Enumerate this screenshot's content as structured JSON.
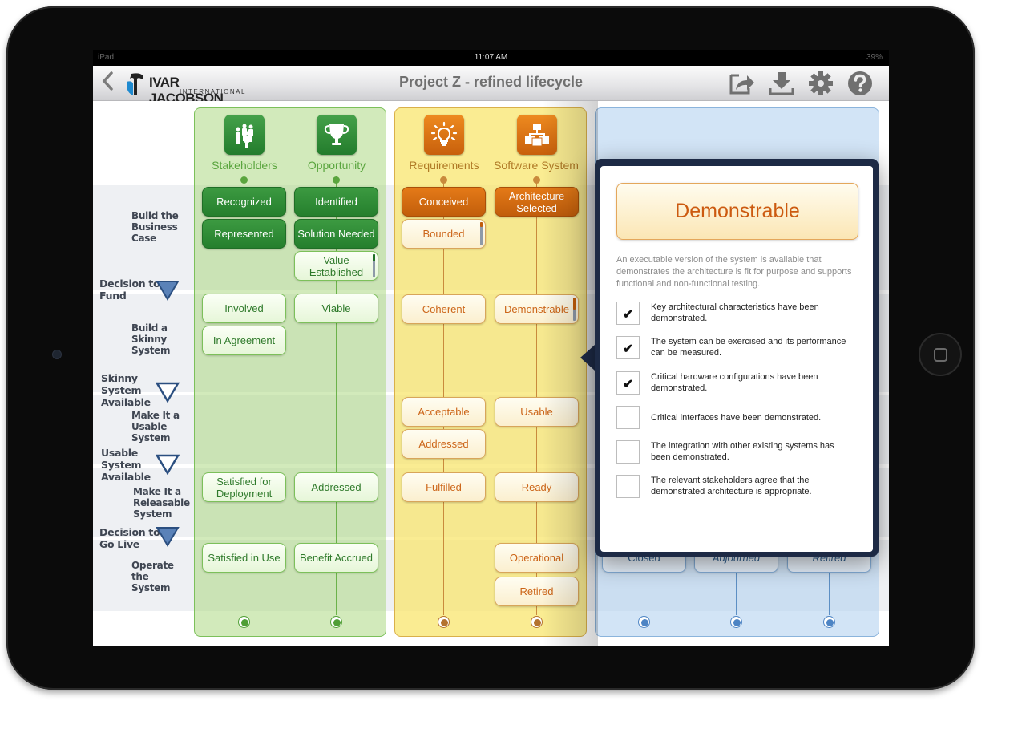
{
  "status_bar": {
    "device": "iPad",
    "time": "11:07 AM",
    "battery": "39%"
  },
  "nav": {
    "back_icon": "chevron-left-icon",
    "logo_name": "IVAR JACOBSON",
    "logo_sub": "INTERNATIONAL",
    "title": "Project Z - refined lifecycle",
    "icons": [
      "share-icon",
      "download-icon",
      "gear-icon",
      "help-icon"
    ]
  },
  "colors": {
    "green": "#2f8a35",
    "orange": "#d86d12",
    "blue": "#4d84c4",
    "popover_frame": "#1d2a45"
  },
  "phases": {
    "activities": [
      "Build the Business Case",
      "Build a Skinny System",
      "Make It a Usable System",
      "Make It a Releasable System",
      "Operate the System"
    ],
    "milestones": [
      {
        "label": "Decision to Fund",
        "style": "filled"
      },
      {
        "label": "Skinny System Available",
        "style": "outline"
      },
      {
        "label": "Usable System Available",
        "style": "outline"
      },
      {
        "label": "Decision to Go Live",
        "style": "filled"
      }
    ]
  },
  "alphas": [
    {
      "name": "Stakeholders",
      "icon": "people-icon",
      "states": [
        "Recognized",
        "Represented",
        "Involved",
        "In Agreement",
        "Satisfied for Deployment",
        "Satisfied in Use"
      ]
    },
    {
      "name": "Opportunity",
      "icon": "trophy-icon",
      "states": [
        "Identified",
        "Solution Needed",
        "Value Established",
        "Viable",
        "Addressed",
        "Benefit Accrued"
      ]
    },
    {
      "name": "Requirements",
      "icon": "lightbulb-icon",
      "states": [
        "Conceived",
        "Bounded",
        "Coherent",
        "Acceptable",
        "Addressed",
        "Fulfilled"
      ]
    },
    {
      "name": "Software System",
      "icon": "hierarchy-icon",
      "states": [
        "Architecture Selected",
        "Demonstrable",
        "Usable",
        "Ready",
        "Operational",
        "Retired"
      ]
    }
  ],
  "blue_states": [
    "Closed",
    "Adjourned",
    "Retired"
  ],
  "popover": {
    "title": "Demonstrable",
    "description": "An executable version of the system is available that demonstrates the architecture is fit for purpose and supports functional and non-functional testing.",
    "checklist": [
      {
        "text": "Key architectural characteristics have been demonstrated.",
        "checked": true
      },
      {
        "text": "The system can be exercised and its performance can be measured.",
        "checked": true
      },
      {
        "text": "Critical hardware configurations have been demonstrated.",
        "checked": true
      },
      {
        "text": "Critical interfaces have been demonstrated.",
        "checked": false
      },
      {
        "text": "The integration with other existing systems has been demonstrated.",
        "checked": false
      },
      {
        "text": "The relevant stakeholders agree that the demonstrated architecture is appropriate.",
        "checked": false
      }
    ]
  },
  "progress": {
    "value_established": 0.3,
    "bounded": 0.2,
    "demonstrable": 0.5
  }
}
